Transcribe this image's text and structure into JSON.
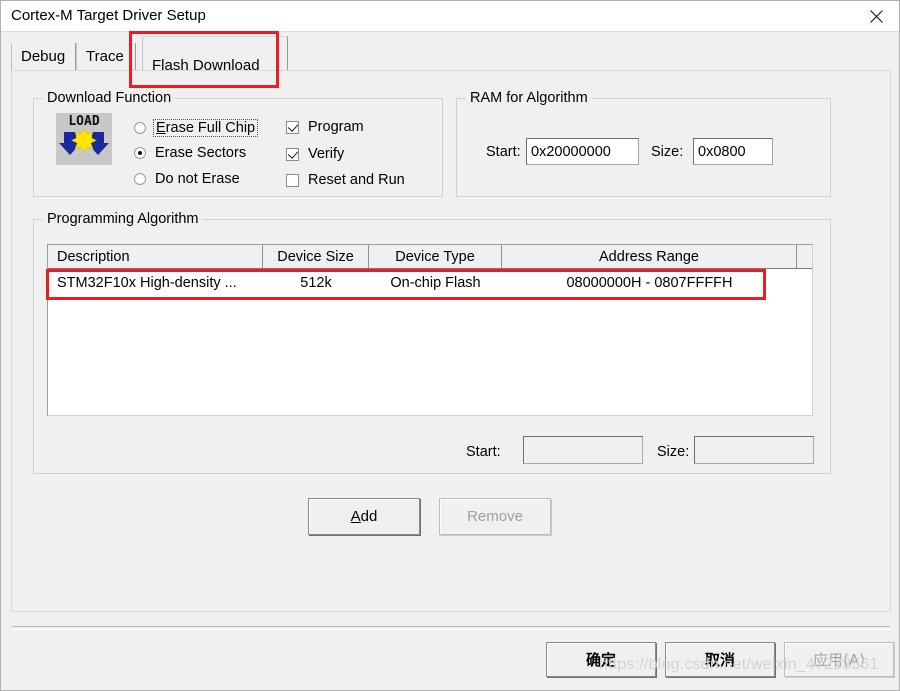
{
  "window": {
    "title": "Cortex-M Target Driver Setup",
    "close_icon": "close-icon"
  },
  "tabs": [
    {
      "label": "Debug",
      "selected": false
    },
    {
      "label": "Trace",
      "selected": false
    },
    {
      "label": "Flash Download",
      "selected": true
    }
  ],
  "download_function": {
    "group_title": "Download Function",
    "icon_label": "LOAD",
    "radios": [
      {
        "label": "Erase Full Chip",
        "accel": "E",
        "checked": false,
        "focused": true
      },
      {
        "label": "Erase Sectors",
        "accel": "",
        "checked": true,
        "focused": false
      },
      {
        "label": "Do not Erase",
        "accel": "",
        "checked": false,
        "focused": false
      }
    ],
    "checkboxes": [
      {
        "label": "Program",
        "checked": true
      },
      {
        "label": "Verify",
        "checked": true
      },
      {
        "label": "Reset and Run",
        "checked": false
      }
    ]
  },
  "ram_for_algorithm": {
    "group_title": "RAM for Algorithm",
    "start_label": "Start:",
    "start_value": "0x20000000",
    "size_label": "Size:",
    "size_value": "0x0800"
  },
  "programming_algorithm": {
    "group_title": "Programming Algorithm",
    "columns": [
      "Description",
      "Device Size",
      "Device Type",
      "Address Range",
      ""
    ],
    "rows": [
      {
        "description": "STM32F10x High-density ...",
        "device_size": "512k",
        "device_type": "On-chip Flash",
        "address_range": "08000000H - 0807FFFFH",
        "extra": "",
        "highlighted": true
      }
    ],
    "start_label": "Start:",
    "start_value": "",
    "size_label": "Size:",
    "size_value": "",
    "add_label": "Add",
    "add_accel": "A",
    "remove_label": "Remove",
    "remove_enabled": false
  },
  "dialog_buttons": [
    {
      "label": "确定",
      "enabled": true
    },
    {
      "label": "取消",
      "enabled": true
    },
    {
      "label": "应用(A)",
      "enabled": false
    }
  ],
  "watermark": "https://blog.csdn.net/weixin_47223561",
  "colors": {
    "annotation": "#ec1c24",
    "dialog_bg": "#f0f0f0",
    "field_bg": "#ffffff",
    "icon_blue": "#1a2a9e",
    "icon_yellow": "#ffe600"
  }
}
